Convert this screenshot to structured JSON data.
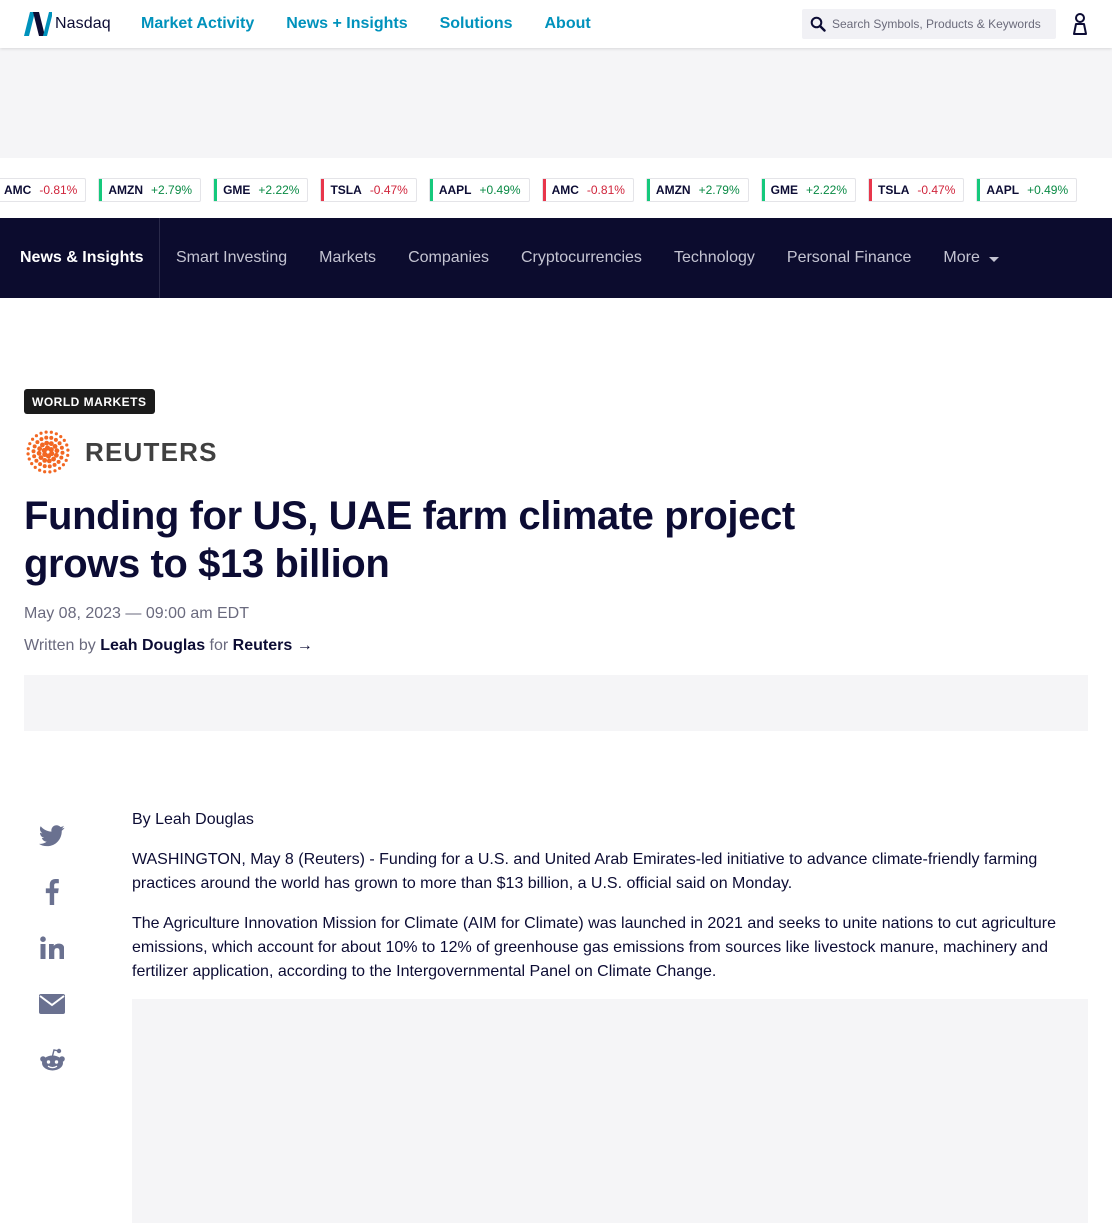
{
  "header": {
    "logo_text": "Nasdaq",
    "nav": [
      "Market Activity",
      "News + Insights",
      "Solutions",
      "About"
    ],
    "search_placeholder": "Search Symbols, Products & Keywords",
    "accent": "#0092bc"
  },
  "ticker": [
    {
      "symbol": "AMC",
      "change": "-0.81%",
      "dir": "down"
    },
    {
      "symbol": "AMZN",
      "change": "+2.79%",
      "dir": "up"
    },
    {
      "symbol": "GME",
      "change": "+2.22%",
      "dir": "up"
    },
    {
      "symbol": "TSLA",
      "change": "-0.47%",
      "dir": "down"
    },
    {
      "symbol": "AAPL",
      "change": "+0.49%",
      "dir": "up"
    },
    {
      "symbol": "AMC",
      "change": "-0.81%",
      "dir": "down"
    },
    {
      "symbol": "AMZN",
      "change": "+2.79%",
      "dir": "up"
    },
    {
      "symbol": "GME",
      "change": "+2.22%",
      "dir": "up"
    },
    {
      "symbol": "TSLA",
      "change": "-0.47%",
      "dir": "down"
    },
    {
      "symbol": "AAPL",
      "change": "+0.49%",
      "dir": "up"
    }
  ],
  "section_nav": {
    "brand": "News & Insights",
    "links": [
      "Smart Investing",
      "Markets",
      "Companies",
      "Cryptocurrencies",
      "Technology",
      "Personal Finance"
    ],
    "more": "More"
  },
  "article": {
    "category": "WORLD MARKETS",
    "source_logo_text": "REUTERS",
    "headline": "Funding for US, UAE farm climate project grows to $13 billion",
    "date": "May 08, 2023 — 09:00 am EDT",
    "byline_prefix": "Written by",
    "author": "Leah Douglas",
    "byline_for": "for",
    "source": "Reuters →",
    "paragraphs": [
      "By Leah Douglas",
      "WASHINGTON, May 8 (Reuters) - Funding for a U.S. and United Arab Emirates-led initiative to advance climate-friendly farming practices around the world has grown to more than $13 billion, a U.S. official said on Monday.",
      "The Agriculture Innovation Mission for Climate (AIM for Climate) was launched in 2021 and seeks to unite nations to cut agriculture emissions, which account for about 10% to 12% of greenhouse gas emissions from sources like livestock manure, machinery and fertilizer application, according to the Intergovernmental Panel on Climate Change."
    ]
  },
  "share_icons": [
    "twitter-icon",
    "facebook-icon",
    "linkedin-icon",
    "email-icon",
    "reddit-icon"
  ]
}
